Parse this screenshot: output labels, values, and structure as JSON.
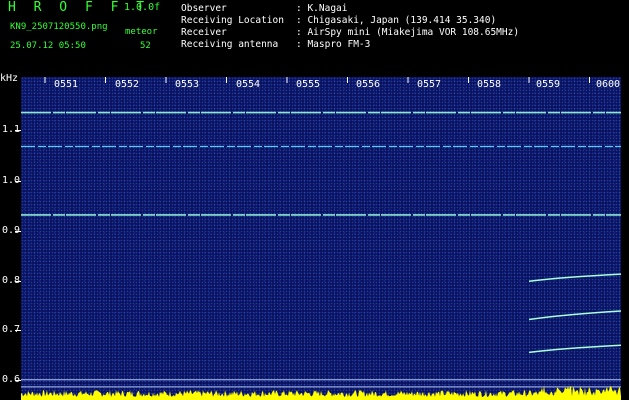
{
  "header": {
    "app_title": "H R O F F T",
    "version": "1.0.0f",
    "file_name": "KN9_2507120550.png",
    "mode": "meteor",
    "datetime": "25.07.12 05:50",
    "count": "52"
  },
  "info": [
    {
      "label": "Observer",
      "value": ": K.Nagai"
    },
    {
      "label": "Receiving Location",
      "value": ": Chigasaki, Japan (139.414 35.340)"
    },
    {
      "label": "Receiver",
      "value": ": AirSpy mini (Miakejima VOR 108.65MHz)"
    },
    {
      "label": "Receiving antenna",
      "value": ": Maspro FM-3"
    }
  ],
  "colors": {
    "accent_green": "#33ff33",
    "text_white": "#ffffff",
    "plot_bg": "#0a1260",
    "echo": "#aaffdd",
    "baseline_yellow": "#ffff00"
  },
  "spectrogram": {
    "y_unit": "kHz",
    "time_ticks": [
      "0551",
      "0552",
      "0553",
      "0554",
      "0555",
      "0556",
      "0557",
      "0558",
      "0559",
      "0600"
    ],
    "freq_ticks": [
      "1.1",
      "1.0",
      "0.9",
      "0.8",
      "0.7",
      "0.6"
    ],
    "freq_range": [
      0.58,
      1.17
    ],
    "horizontal_lines_khz": [
      1.105,
      1.043,
      0.918,
      0.617,
      0.604
    ],
    "meteor_echoes": [
      {
        "start_min": 8.0,
        "end_min": 9.9,
        "f_start_khz": 0.797,
        "f_end_khz": 0.812
      },
      {
        "start_min": 8.0,
        "end_min": 9.9,
        "f_start_khz": 0.727,
        "f_end_khz": 0.745
      },
      {
        "start_min": 8.0,
        "end_min": 9.9,
        "f_start_khz": 0.667,
        "f_end_khz": 0.682
      }
    ]
  }
}
